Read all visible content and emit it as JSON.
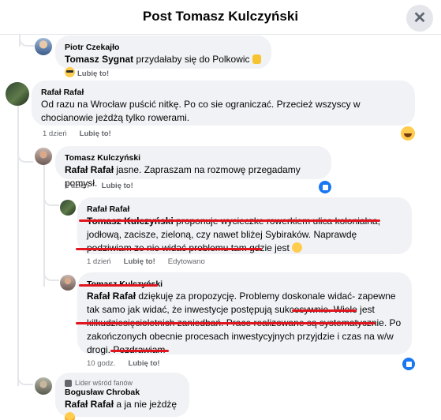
{
  "header": {
    "title": "Post Tomasz Kulczyński",
    "close": "✕"
  },
  "comments": [
    {
      "author": "Piotr Czekajło",
      "mention": "Tomasz Sygnat",
      "text": " przydałaby się do Polkowic ",
      "time": "",
      "like": "Lubię to!"
    },
    {
      "author": "Rafał Rafał",
      "mention": "",
      "text": "Od razu na Wrocław puścić nitkę. Po co sie ograniczać. Przecież wszyscy w chocianowie jeżdżą tylko rowerami.",
      "time": "1 dzień",
      "like": "Lubię to!"
    },
    {
      "author": "Tomasz Kulczyński",
      "mention": "Rafał Rafał",
      "text": " jasne. Zapraszam na rozmowę przegadamy pomysł.",
      "time": "1 dzień",
      "like": "Lubię to!"
    },
    {
      "author": "Rafał Rafał",
      "mention": "Tomasz Kulczyński",
      "text": " proponuje wycieczke rowerkiem ulica kolonialna, jodłową, zacisze, zieloną, czy nawet bliżej Sybiraków. Naprawdę podziwiam ze nie widać problemu tam gdzie jest ",
      "time": "1 dzień",
      "like": "Lubię to!",
      "edited": "Edytowano"
    },
    {
      "author": "Tomasz Kulczyński",
      "mention": "Rafał Rafał",
      "text": " dziękuję za propozycję. Problemy doskonale widać- zapewne tak samo jak widać, że inwestycje postępują sukcesywnie. Wiele jest kilkudziesięcioletnich zaniedbań. Prace realizowane są systematycznie. Po zakończonych obecnie procesach inwestycyjnych przyjdzie i czas na w/w drogi. Pozdrawiam",
      "time": "10 godz.",
      "like": "Lubię to!"
    },
    {
      "badge": "Lider wśród fanów",
      "author": "Bogusław Chrobak",
      "mention": "Rafał Rafał",
      "text": " a ja nie jeżdżę ",
      "time": "",
      "like": ""
    }
  ],
  "icons": {
    "close": "close-icon",
    "laugh_reaction": "laugh-reaction-icon",
    "like_reaction": "like-reaction-icon",
    "fan_badge": "fan-badge-icon"
  },
  "colors": {
    "annotation_red": "#e0151e",
    "bubble": "#f0f2f5",
    "like_blue": "#1877f2"
  }
}
